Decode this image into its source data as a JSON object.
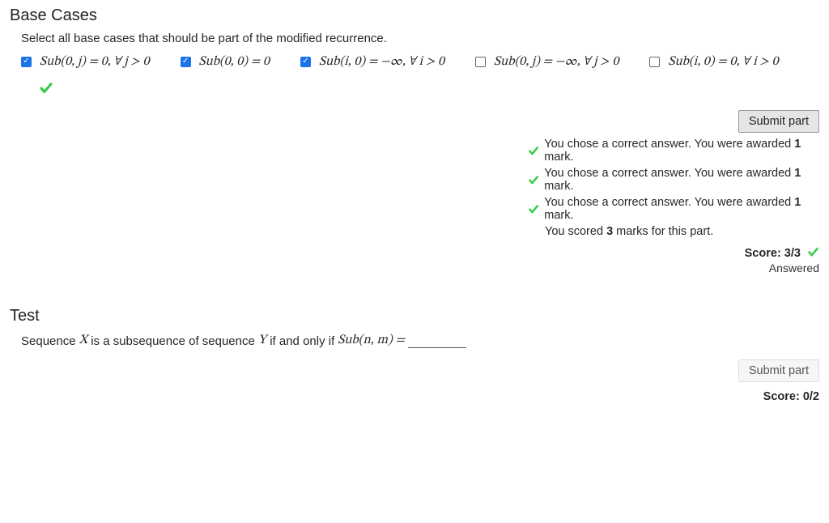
{
  "part1": {
    "title": "Base Cases",
    "instruction": "Select all base cases that should be part of the modified recurrence.",
    "options": [
      {
        "checked": true,
        "formula": "Sub(0, j) = 0, ∀ j > 0"
      },
      {
        "checked": true,
        "formula": "Sub(0, 0) = 0"
      },
      {
        "checked": true,
        "formula": "Sub(i, 0) = −∞, ∀ i > 0"
      },
      {
        "checked": false,
        "formula": "Sub(0, j) = −∞, ∀ j > 0"
      },
      {
        "checked": false,
        "formula": "Sub(i, 0) = 0, ∀ i > 0"
      }
    ],
    "submit_label": "Submit part",
    "feedback": [
      {
        "tick": true,
        "pre": "You chose a correct answer. You were awarded ",
        "bold": "1",
        "post": " mark."
      },
      {
        "tick": true,
        "pre": "You chose a correct answer. You were awarded ",
        "bold": "1",
        "post": " mark."
      },
      {
        "tick": true,
        "pre": "You chose a correct answer. You were awarded ",
        "bold": "1",
        "post": " mark."
      },
      {
        "tick": false,
        "pre": "You scored ",
        "bold": "3",
        "post": " marks for this part."
      }
    ],
    "score_label": "Score: 3/3",
    "answered_label": "Answered"
  },
  "part2": {
    "title": "Test",
    "prompt_pre": "Sequence ",
    "X": "X",
    "mid1": " is a subsequence of sequence ",
    "Y": "Y",
    "mid2": " if and only if ",
    "func": "Sub(n, m) = ",
    "input_value": "",
    "submit_label": "Submit part",
    "score_label": "Score: 0/2"
  }
}
